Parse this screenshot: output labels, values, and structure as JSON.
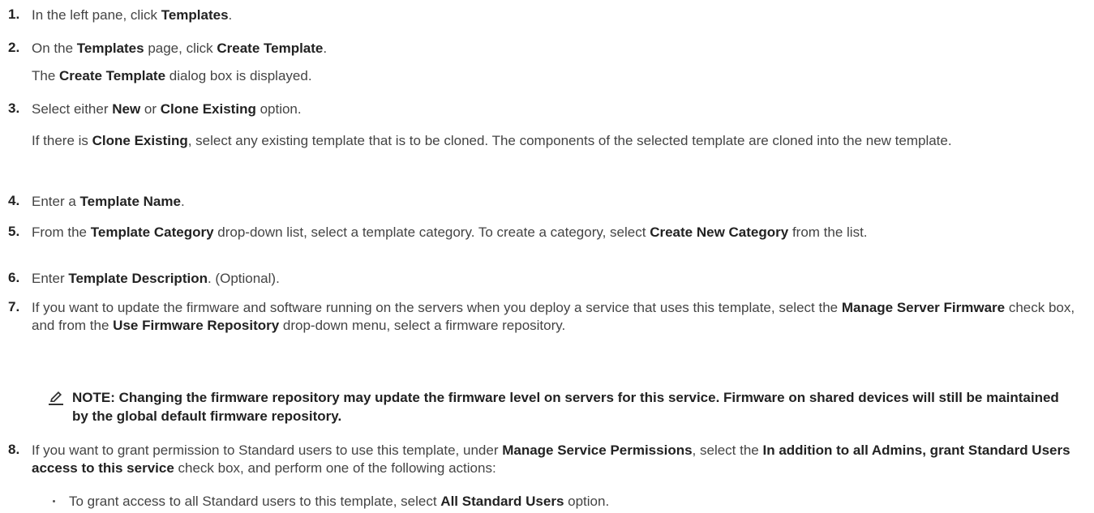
{
  "steps": [
    {
      "num": "1.",
      "parts": [
        "In the left pane, click ",
        "Templates",
        "."
      ]
    },
    {
      "num": "2.",
      "parts": [
        "On the ",
        "Templates",
        " page, click ",
        "Create Template",
        "."
      ]
    },
    {
      "parts": [
        "The ",
        "Create Template",
        " dialog box is displayed."
      ]
    },
    {
      "num": "3.",
      "parts": [
        "Select either ",
        "New",
        " or ",
        "Clone Existing",
        " option."
      ]
    },
    {
      "parts": [
        "If there is ",
        "Clone Existing",
        ", select any existing template that is to be cloned. The components of the selected template are cloned into the new template."
      ]
    },
    {
      "num": "4.",
      "parts": [
        "Enter a ",
        "Template Name",
        "."
      ]
    },
    {
      "num": "5.",
      "parts": [
        "From the ",
        "Template Category",
        " drop-down list, select a template category. To create a category, select ",
        "Create New Category",
        " from the list."
      ]
    },
    {
      "num": "6.",
      "parts": [
        "Enter ",
        "Template Description",
        ". (Optional)."
      ]
    },
    {
      "num": "7.",
      "parts": [
        "If you want to update the firmware and software running on the servers when you deploy a service that uses this template, select the ",
        "Manage Server Firmware",
        " check box, and from the ",
        "Use Firmware Repository",
        " drop-down menu, select a firmware repository."
      ]
    },
    {
      "num": "8.",
      "parts": [
        "If you want to grant permission to Standard users to use this template, under ",
        "Manage Service Permissions",
        ", select the ",
        "In addition to all Admins, grant Standard Users access to this service",
        " check box, and perform one of the following actions:"
      ]
    }
  ],
  "note": {
    "icon": "pencil-note-icon",
    "text": "NOTE: Changing the firmware repository may update the firmware level on servers for this service. Firmware on shared devices will still be maintained by the global default firmware repository."
  },
  "bullet": {
    "parts": [
      "To grant access to all Standard users to this template, select ",
      "All Standard Users",
      " option."
    ]
  }
}
